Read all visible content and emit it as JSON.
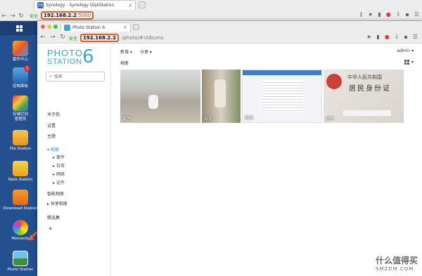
{
  "outer_browser": {
    "tab_title": "Synology - Synology DiskStation",
    "secure_label": "安全",
    "url_host": "192.168.2.2",
    "url_rest": ":5000"
  },
  "desktop": {
    "items": [
      {
        "label": "套件中心"
      },
      {
        "label": "控制面板",
        "badge": "1"
      },
      {
        "label": "存储空间\n管理员"
      },
      {
        "label": "File Station"
      },
      {
        "label": "Note Station"
      },
      {
        "label": "Download Station"
      },
      {
        "label": "Moments"
      },
      {
        "label": "Photo Station"
      }
    ]
  },
  "inner_browser": {
    "tab_title": "Photo Station 6",
    "secure_label": "安全",
    "url_host": "192.168.2.2",
    "url_rest": "/photo/#!Albums"
  },
  "photostation": {
    "logo_line1": "PHOTO",
    "logo_line2": "STATION",
    "logo_num": "6",
    "search_placeholder": "搜索",
    "nav": {
      "about": "关于我",
      "settings": "设置",
      "theme": "主题",
      "albums": "相册",
      "smart": "智能相册",
      "shared": "共享相册",
      "featured": "精选集"
    },
    "sub_albums": [
      "事件",
      "日常",
      "网络",
      "证件"
    ],
    "toolbar": {
      "new": "新增",
      "share": "分享"
    },
    "user": "admin",
    "breadcrumb": "相册",
    "albums": [
      {
        "label": "事件"
      },
      {
        "label": "日常"
      },
      {
        "label": "网络"
      },
      {
        "label": "证件",
        "card_text": "中华人民共和国",
        "card_title": "居民身份证"
      }
    ]
  },
  "watermark": {
    "text": "什么值得买",
    "sub": "SMZDM.COM"
  }
}
